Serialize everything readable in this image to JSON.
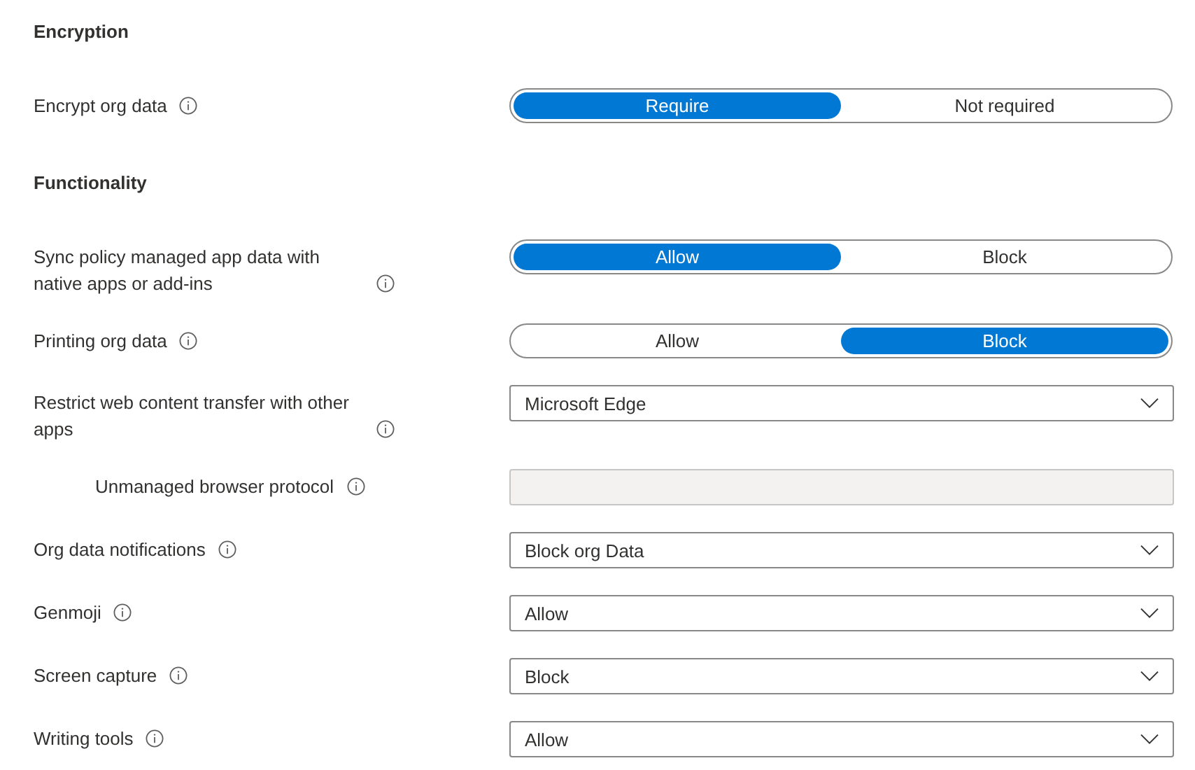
{
  "sections": [
    {
      "heading": "Encryption",
      "settings": [
        {
          "label": "Encrypt org data",
          "kind": "toggle",
          "options": [
            {
              "label": "Require",
              "selected": true
            },
            {
              "label": "Not required",
              "selected": false
            }
          ]
        }
      ]
    },
    {
      "heading": "Functionality",
      "settings": [
        {
          "label": "Sync policy managed app data with native apps or add-ins",
          "kind": "toggle",
          "options": [
            {
              "label": "Allow",
              "selected": true
            },
            {
              "label": "Block",
              "selected": false
            }
          ]
        },
        {
          "label": "Printing org data",
          "kind": "toggle",
          "options": [
            {
              "label": "Allow",
              "selected": false
            },
            {
              "label": "Block",
              "selected": true
            }
          ]
        },
        {
          "label": "Restrict web content transfer with other apps",
          "kind": "dropdown",
          "value": "Microsoft Edge",
          "children": [
            {
              "label": "Unmanaged browser protocol",
              "kind": "textbox",
              "disabled": true
            }
          ]
        },
        {
          "label": "Org data notifications",
          "kind": "dropdown",
          "value": "Block org Data"
        },
        {
          "label": "Genmoji",
          "kind": "dropdown",
          "value": "Allow"
        },
        {
          "label": "Screen capture",
          "kind": "dropdown",
          "value": "Block"
        },
        {
          "label": "Writing tools",
          "kind": "dropdown",
          "value": "Allow"
        }
      ]
    }
  ]
}
